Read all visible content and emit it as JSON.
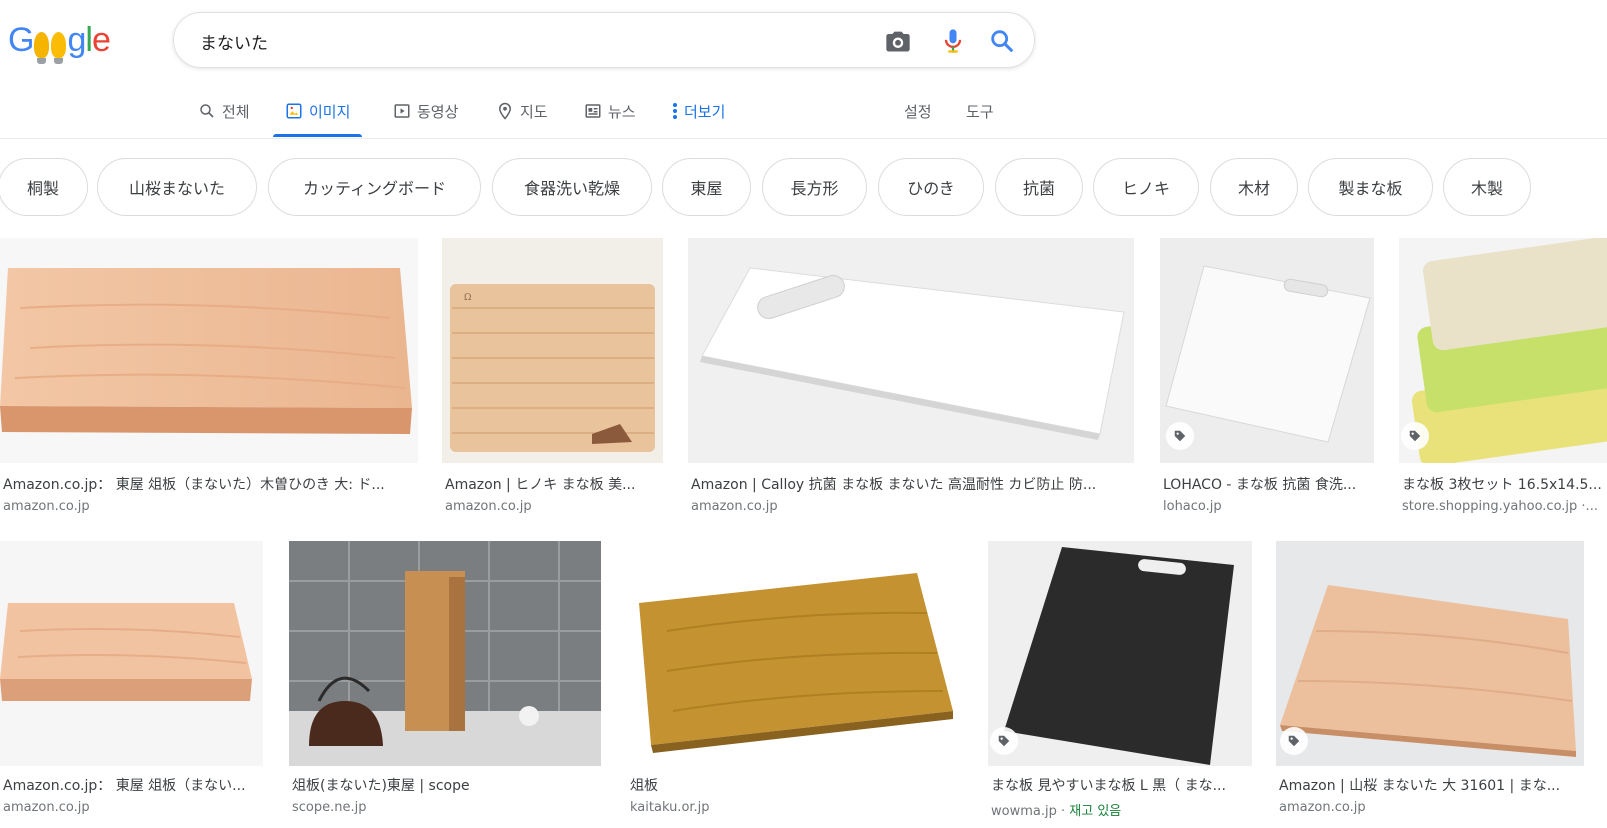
{
  "search": {
    "query": "まないた"
  },
  "colors": {
    "accent": "#1a73e8",
    "stock": "#188038"
  },
  "logo": {
    "letters": [
      "G",
      "g",
      "l",
      "e"
    ]
  },
  "tabs": {
    "all": "전체",
    "images": "이미지",
    "videos": "동영상",
    "maps": "지도",
    "news": "뉴스",
    "more": "더보기",
    "settings": "설정",
    "tools": "도구"
  },
  "chips": [
    "桐製",
    "山桜まないた",
    "カッティングボード",
    "食器洗い乾燥",
    "東屋",
    "長方形",
    "ひのき",
    "抗菌",
    "ヒノキ",
    "木材",
    "製まな板",
    "木製"
  ],
  "results": [
    {
      "title": "Amazon.co.jp： 東屋 俎板（まないた）木曽ひのき 大: ド...",
      "source": "amazon.co.jp"
    },
    {
      "title": "Amazon | ヒノキ まな板 美...",
      "source": "amazon.co.jp"
    },
    {
      "title": "Amazon | Calloy 抗菌 まな板 まないた 高温耐性 カビ防止 防...",
      "source": "amazon.co.jp"
    },
    {
      "title": "LOHACO - まな板 抗菌 食洗...",
      "source": "lohaco.jp"
    },
    {
      "title": "まな板 3枚セット 16.5x14.5...",
      "source": "store.shopping.yahoo.co.jp ·..."
    },
    {
      "title": "Amazon.co.jp： 東屋 俎板（まない...",
      "source": "amazon.co.jp"
    },
    {
      "title": "俎板(まないた)東屋 | scope",
      "source": "scope.ne.jp"
    },
    {
      "title": "俎板",
      "source": "kaitaku.or.jp"
    },
    {
      "title": "まな板 見やすいまな板 L 黒（ まな...",
      "source": "wowma.jp",
      "extra": "재고 있음"
    },
    {
      "title": "Amazon | 山桜 まないた 大 31601 | まな...",
      "source": "amazon.co.jp"
    }
  ]
}
